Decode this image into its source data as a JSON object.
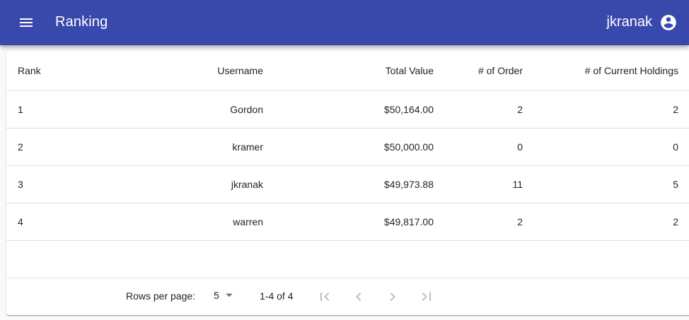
{
  "appbar": {
    "title": "Ranking",
    "username": "jkranak",
    "menu_icon": "menu-icon",
    "account_icon": "account-circle-icon"
  },
  "table": {
    "headers": [
      "Rank",
      "Username",
      "Total Value",
      "# of Order",
      "# of Current Holdings"
    ],
    "rows": [
      {
        "rank": "1",
        "username": "Gordon",
        "total": "$50,164.00",
        "orders": "2",
        "holdings": "2"
      },
      {
        "rank": "2",
        "username": "kramer",
        "total": "$50,000.00",
        "orders": "0",
        "holdings": "0"
      },
      {
        "rank": "3",
        "username": "jkranak",
        "total": "$49,973.88",
        "orders": "11",
        "holdings": "5"
      },
      {
        "rank": "4",
        "username": "warren",
        "total": "$49,817.00",
        "orders": "2",
        "holdings": "2"
      }
    ]
  },
  "pagination": {
    "rows_per_page_label": "Rows per page:",
    "rows_per_page_value": "5",
    "range_label": "1-4 of 4"
  },
  "colors": {
    "appbar": "#3949ab",
    "disabled_icon": "rgba(0,0,0,0.26)"
  }
}
